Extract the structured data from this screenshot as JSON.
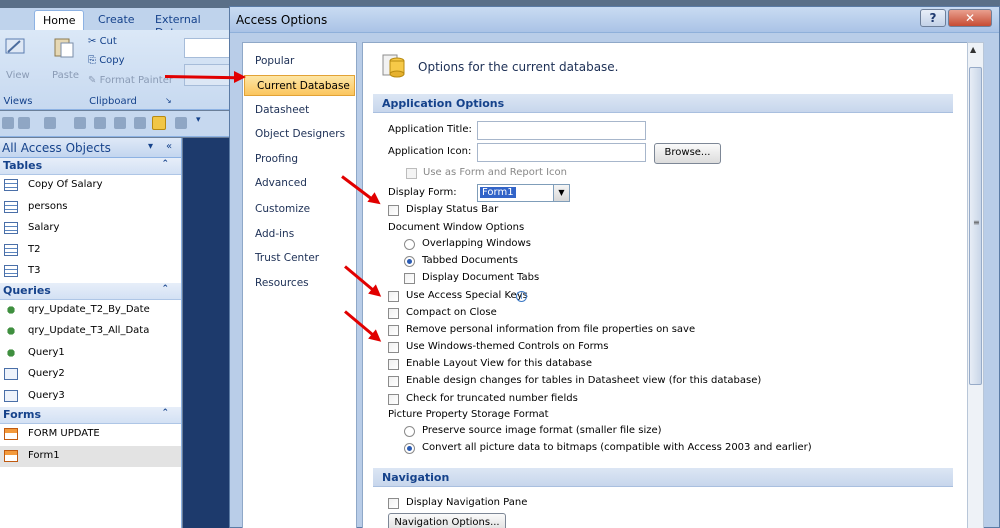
{
  "ribbon": {
    "tabs": [
      "Home",
      "Create",
      "External Data"
    ],
    "active_tab": "Home",
    "views_button": "View",
    "views_group": "Views",
    "paste_button": "Paste",
    "cut": "Cut",
    "copy": "Copy",
    "format_painter": "Format Painter",
    "clipboard_group": "Clipboard"
  },
  "nav_pane": {
    "title": "All Access Objects",
    "groups": [
      {
        "name": "Tables",
        "items": [
          "Copy Of Salary",
          "persons",
          "Salary",
          "T2",
          "T3"
        ]
      },
      {
        "name": "Queries",
        "items": [
          "qry_Update_T2_By_Date",
          "qry_Update_T3_All_Data",
          "Query1",
          "Query2",
          "Query3"
        ]
      },
      {
        "name": "Forms",
        "items": [
          "FORM UPDATE",
          "Form1"
        ]
      }
    ],
    "selected_item": "Form1"
  },
  "dialog": {
    "title": "Access Options",
    "help_label": "?",
    "close_label": "✕",
    "categories": [
      "Popular",
      "Current Database",
      "Datasheet",
      "Object Designers",
      "Proofing",
      "Advanced",
      "Customize",
      "Add-ins",
      "Trust Center",
      "Resources"
    ],
    "active_category": "Current Database",
    "banner": "Options for the current database.",
    "application_options": {
      "header": "Application Options",
      "app_title_label": "Application Title:",
      "app_title_value": "",
      "app_icon_label": "Application Icon:",
      "app_icon_value": "",
      "browse_button": "Browse...",
      "use_as_form_icon": "Use as Form and Report Icon",
      "display_form_label": "Display Form:",
      "display_form_value": "Form1",
      "display_status_bar": "Display Status Bar",
      "doc_window_options": "Document Window Options",
      "overlapping_windows": "Overlapping Windows",
      "tabbed_documents": "Tabbed Documents",
      "display_document_tabs": "Display Document Tabs",
      "use_special_keys": "Use Access Special Keys",
      "compact_on_close": "Compact on Close",
      "remove_personal_info": "Remove personal information from file properties on save",
      "windows_themed_controls": "Use Windows-themed Controls on Forms",
      "enable_layout_view": "Enable Layout View for this database",
      "enable_design_changes": "Enable design changes for tables in Datasheet view (for this database)",
      "check_truncated": "Check for truncated number fields",
      "picture_storage": "Picture Property Storage Format",
      "preserve_source": "Preserve source image format (smaller file size)",
      "convert_bitmaps": "Convert all picture data to bitmaps (compatible with Access 2003 and earlier)"
    },
    "navigation": {
      "header": "Navigation",
      "display_nav_pane": "Display Navigation Pane",
      "nav_options_button": "Navigation Options..."
    }
  },
  "colors": {
    "accent_red": "#e10000",
    "active_category": "#fbc55e",
    "section_text": "#15428b"
  }
}
